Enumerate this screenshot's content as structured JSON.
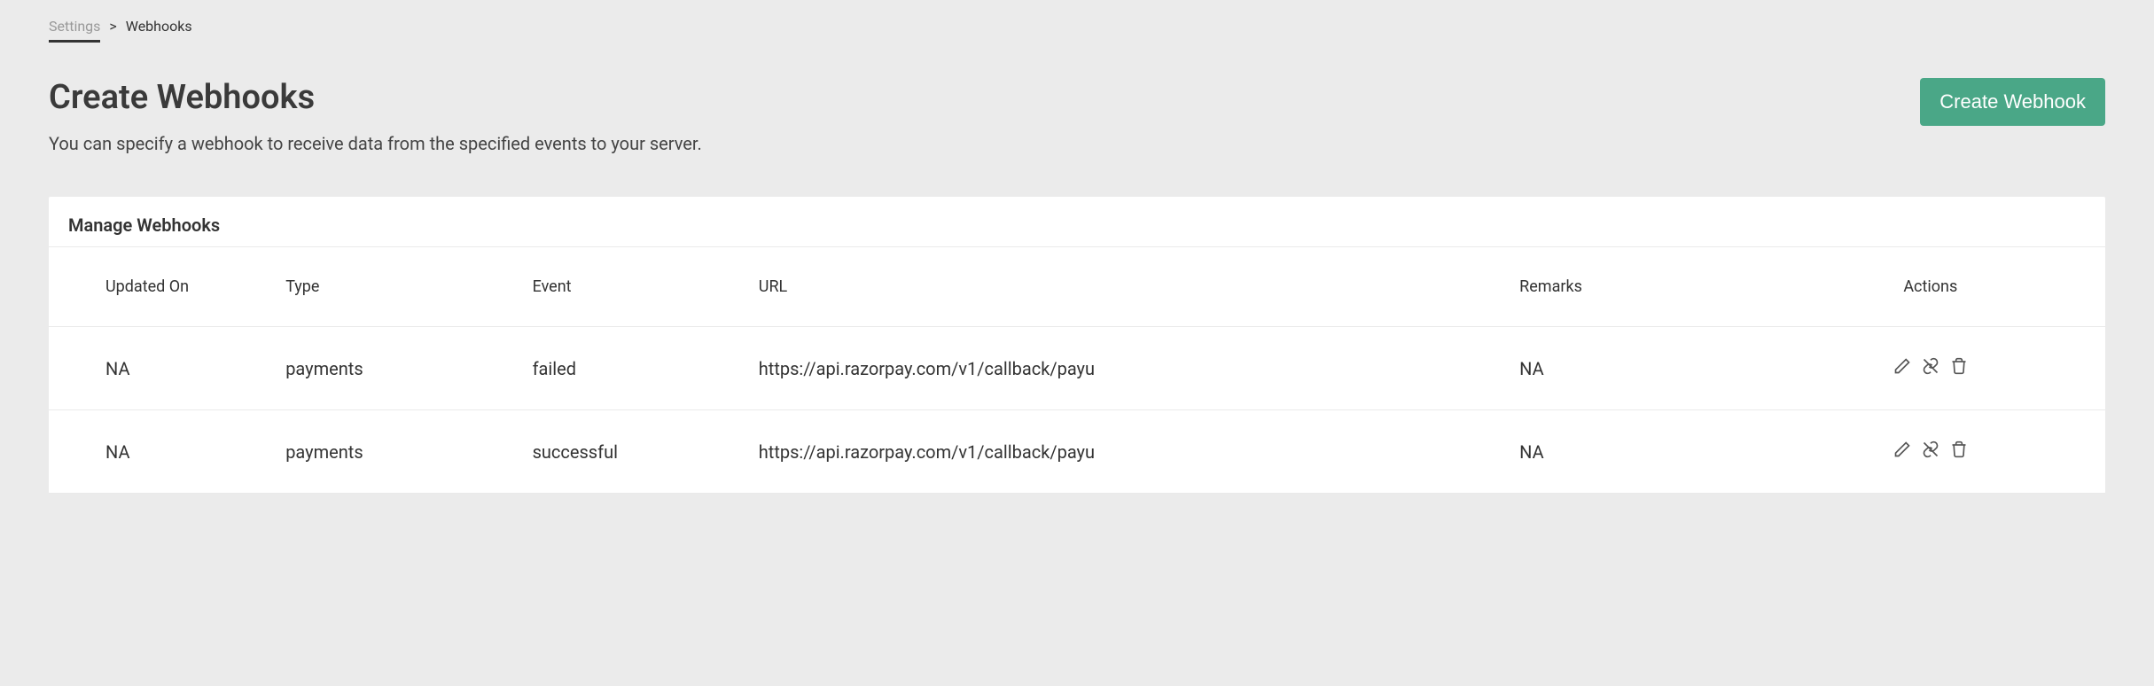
{
  "breadcrumb": {
    "settings": "Settings",
    "sep": ">",
    "current": "Webhooks"
  },
  "header": {
    "title": "Create Webhooks",
    "subtitle": "You can specify a webhook to receive data from the specified events to your server.",
    "create_button": "Create Webhook"
  },
  "card": {
    "title": "Manage Webhooks"
  },
  "table": {
    "headers": {
      "updated_on": "Updated On",
      "type": "Type",
      "event": "Event",
      "url": "URL",
      "remarks": "Remarks",
      "actions": "Actions"
    },
    "rows": [
      {
        "updated_on": "NA",
        "type": "payments",
        "event": "failed",
        "url": "https://api.razorpay.com/v1/callback/payu",
        "remarks": "NA"
      },
      {
        "updated_on": "NA",
        "type": "payments",
        "event": "successful",
        "url": "https://api.razorpay.com/v1/callback/payu",
        "remarks": "NA"
      }
    ]
  }
}
